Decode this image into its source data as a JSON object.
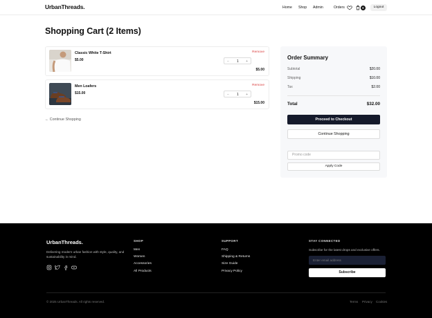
{
  "header": {
    "logo": "UrbanThreads.",
    "nav": [
      "Home",
      "Shop",
      "Admin"
    ],
    "orders_label": "Orders",
    "cart_count": "0",
    "logout_label": "Logout"
  },
  "page": {
    "title": "Shopping Cart (2 Items)"
  },
  "cart": {
    "remove_label": "Remove",
    "items": [
      {
        "name": "Classic White T-Shirt",
        "price": "$5.00",
        "quantity": "1",
        "line_total": "$5.00",
        "minus": "−",
        "plus": "+"
      },
      {
        "name": "Men Loafers",
        "price": "$15.00",
        "quantity": "1",
        "line_total": "$15.00",
        "minus": "−",
        "plus": "+"
      }
    ],
    "continue_label": "← Continue Shopping"
  },
  "summary": {
    "title": "Order Summary",
    "subtotal_label": "Subtotal",
    "subtotal_value": "$20.00",
    "shipping_label": "Shipping",
    "shipping_value": "$10.00",
    "tax_label": "Tax",
    "tax_value": "$2.00",
    "total_label": "Total",
    "total_value": "$32.00",
    "checkout_label": "Proceed to Checkout",
    "continue_label": "Continue Shopping",
    "promo_placeholder": "Promo code",
    "apply_label": "Apply Code"
  },
  "footer": {
    "logo": "UrbanThreads.",
    "description": "Delivering modern urban fashion with style, quality, and sustainability in mind.",
    "shop_title": "SHOP",
    "shop_links": [
      "Men",
      "Women",
      "Accessories",
      "All Products"
    ],
    "support_title": "SUPPORT",
    "support_links": [
      "FAQ",
      "Shipping & Returns",
      "Size Guide",
      "Privacy Policy"
    ],
    "connect_title": "STAY CONNECTED",
    "connect_desc": "Subscribe for the latest drops and exclusive offers.",
    "email_placeholder": "Enter email address",
    "subscribe_label": "Subscribe",
    "copyright": "© 2025 UrbanThreads. All rights reserved.",
    "legal_links": [
      "Terms",
      "Privacy",
      "Cookies"
    ]
  },
  "colors": {
    "accent_dark": "#151a2b",
    "remove_red": "#d93b3b",
    "footer_bg": "#000000",
    "summary_bg": "#f7f8fa"
  },
  "icons": [
    "heart-icon",
    "cart-icon",
    "instagram-icon",
    "twitter-icon",
    "facebook-icon",
    "youtube-icon"
  ]
}
